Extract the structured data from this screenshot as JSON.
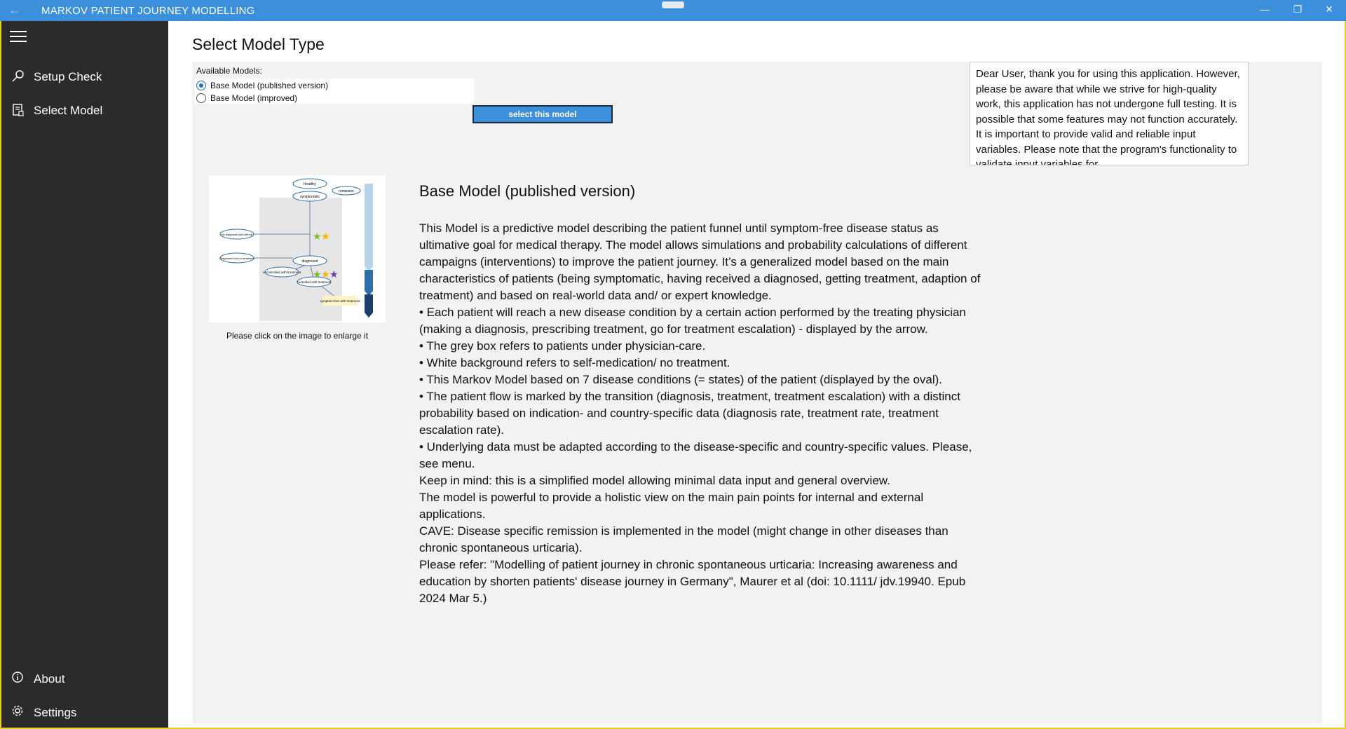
{
  "window": {
    "title": "MARKOV PATIENT JOURNEY MODELLING",
    "back_icon": "←",
    "min_icon": "—",
    "restore_icon": "❐",
    "close_icon": "✕"
  },
  "sidebar": {
    "items": [
      {
        "label": "Setup Check",
        "icon": "search-icon"
      },
      {
        "label": "Select Model",
        "icon": "document-icon"
      },
      {
        "label": "About",
        "icon": "info-icon"
      },
      {
        "label": "Settings",
        "icon": "gear-icon"
      }
    ]
  },
  "page": {
    "title": "Select Model Type",
    "available_label": "Available Models:",
    "models": [
      {
        "label": "Base Model (published version)",
        "selected": true
      },
      {
        "label": "Base Model (improved)",
        "selected": false
      }
    ],
    "select_button": "select this model",
    "notice": "Dear User, thank you for using this application. However, please be aware that while we strive for high-quality work, this application has not undergone full testing. It is possible that some features may not function accurately. It is important to provide valid and reliable input variables. Please note that the program's functionality to validate input variables for",
    "image_caption": "Please click on the image to enlarge it",
    "diagram": {
      "nodes": [
        "healthy",
        "remission",
        "symptomatic",
        "No diagnosis\nself-referral",
        "Diagnosed but\nno treatment",
        "diagnosed",
        "uncontrolled\nwith treatment",
        "controlled\nwith treatment",
        "symptom-free\nwith treatment"
      ]
    },
    "model_title": "Base Model (published version)",
    "model_description": [
      "This Model is a predictive model describing the patient funnel until symptom-free disease status as ultimative goal for medical therapy. The model allows simulations and probability calculations of different campaigns (interventions) to improve the patient journey. It’s a generalized model based on the main characteristics of patients (being symptomatic, having received a diagnosed, getting treatment, adaption of treatment) and based on real-world data and/ or expert knowledge.",
      "• Each patient will reach a new disease condition by a certain action performed by the treating physician (making a diagnosis, prescribing treatment, go for treatment escalation) - displayed by the arrow.",
      "• The grey box refers to patients under physician-care.",
      "• White background refers to self-medication/ no treatment.",
      "• This Markov Model based on 7 disease conditions (= states) of the patient (displayed by the oval).",
      "• The patient flow is marked by the transition (diagnosis, treatment, treatment escalation) with a distinct probability based on indication- and country-specific data (diagnosis rate, treatment rate, treatment escalation rate).",
      "• Underlying data must be adapted according to the disease-specific and country-specific values. Please, see menu.",
      "Keep in mind: this is a simplified model allowing minimal data input and general overview.",
      "The model is powerful to provide a holistic view on the main pain points for internal and external applications.",
      "CAVE: Disease specific remission is implemented in the model (might change in other diseases than chronic spontaneous urticaria).",
      "Please refer: \"Modelling of patient journey in chronic spontaneous urticaria: Increasing awareness and education by shorten patients' disease journey in Germany\", Maurer et al (doi: 10.1111/ jdv.19940. Epub 2024 Mar 5.)"
    ]
  },
  "colors": {
    "titlebar": "#3b8fdb",
    "sidebar": "#2b2b2b",
    "frame": "#e3d21c",
    "accent": "#1f6fc4"
  }
}
